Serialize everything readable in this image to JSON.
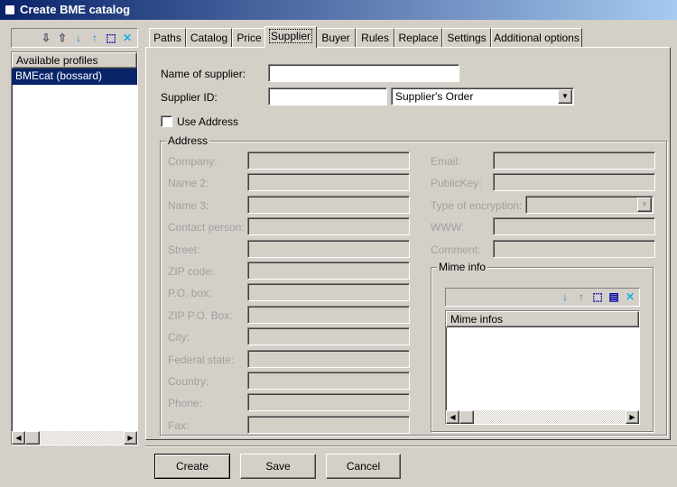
{
  "window": {
    "title": "Create BME catalog"
  },
  "profiles": {
    "header": "Available profiles",
    "items": [
      "BMEcat (bossard)"
    ],
    "toolbar": [
      "import-icon",
      "export-icon",
      "move-down-icon",
      "move-up-icon",
      "new-icon",
      "delete-icon"
    ]
  },
  "tabs": [
    "Paths",
    "Catalog",
    "Price",
    "Supplier",
    "Buyer",
    "Rules",
    "Replace",
    "Settings",
    "Additional options"
  ],
  "active_tab": "Supplier",
  "supplier": {
    "name_label": "Name of supplier:",
    "name_value": "",
    "id_label": "Supplier ID:",
    "id_value": "",
    "id_type": "Supplier's Order",
    "use_address_label": "Use Address",
    "use_address_checked": false
  },
  "address": {
    "title": "Address",
    "left_fields": [
      "Company:",
      "Name 2:",
      "Name 3:",
      "Contact person:",
      "Street:",
      "ZIP code:",
      "P.O. box:",
      "ZIP P.O. Box:",
      "City:",
      "Federal state:",
      "Country:",
      "Phone:",
      "Fax:"
    ],
    "right_fields": [
      "Email:",
      "PublicKey:",
      "Type of encryption:",
      "WWW:",
      "Comment:"
    ]
  },
  "mime": {
    "title": "Mime info",
    "header": "Mime infos"
  },
  "buttons": {
    "create": "Create",
    "save": "Save",
    "cancel": "Cancel"
  }
}
